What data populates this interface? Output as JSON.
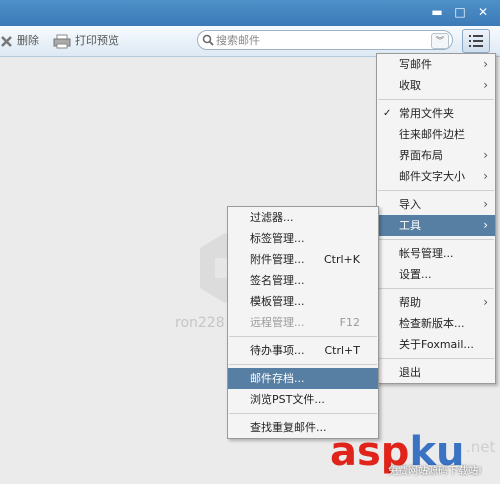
{
  "window": {
    "controls": {
      "minimize": "▬",
      "maximize": "□",
      "close": "✕"
    }
  },
  "toolbar": {
    "delete_label": "删除",
    "print_preview_label": "打印预览",
    "search_placeholder": "搜索邮件"
  },
  "main": {
    "watermark": "ron228"
  },
  "main_menu": [
    {
      "label": "写邮件",
      "arrow": "›"
    },
    {
      "label": "收取",
      "arrow": "›"
    },
    {
      "label": "常用文件夹",
      "check": "✓"
    },
    {
      "label": "往来邮件边栏"
    },
    {
      "label": "界面布局",
      "arrow": "›"
    },
    {
      "label": "邮件文字大小",
      "arrow": "›"
    },
    {
      "label": "导入",
      "arrow": "›"
    },
    {
      "label": "工具",
      "arrow": "›"
    },
    {
      "label": "帐号管理..."
    },
    {
      "label": "设置..."
    },
    {
      "label": "帮助",
      "arrow": "›"
    },
    {
      "label": "检查新版本..."
    },
    {
      "label": "关于Foxmail..."
    },
    {
      "label": "退出"
    }
  ],
  "tools_menu": [
    {
      "label": "过滤器..."
    },
    {
      "label": "标签管理..."
    },
    {
      "label": "附件管理...",
      "shortcut": "Ctrl+K"
    },
    {
      "label": "签名管理..."
    },
    {
      "label": "模板管理..."
    },
    {
      "label": "远程管理...",
      "shortcut": "F12"
    },
    {
      "label": "待办事项...",
      "shortcut": "Ctrl+T"
    },
    {
      "label": "邮件存档..."
    },
    {
      "label": "浏览PST文件..."
    },
    {
      "label": "查找重复邮件..."
    }
  ],
  "site_watermark": {
    "asp": "asp",
    "ku": "ku",
    ".net": ".net",
    "sub": "免费网站源码下载站!"
  },
  "colors": {
    "titlebar": "#3b7ab7",
    "highlight": "#577fa3"
  }
}
